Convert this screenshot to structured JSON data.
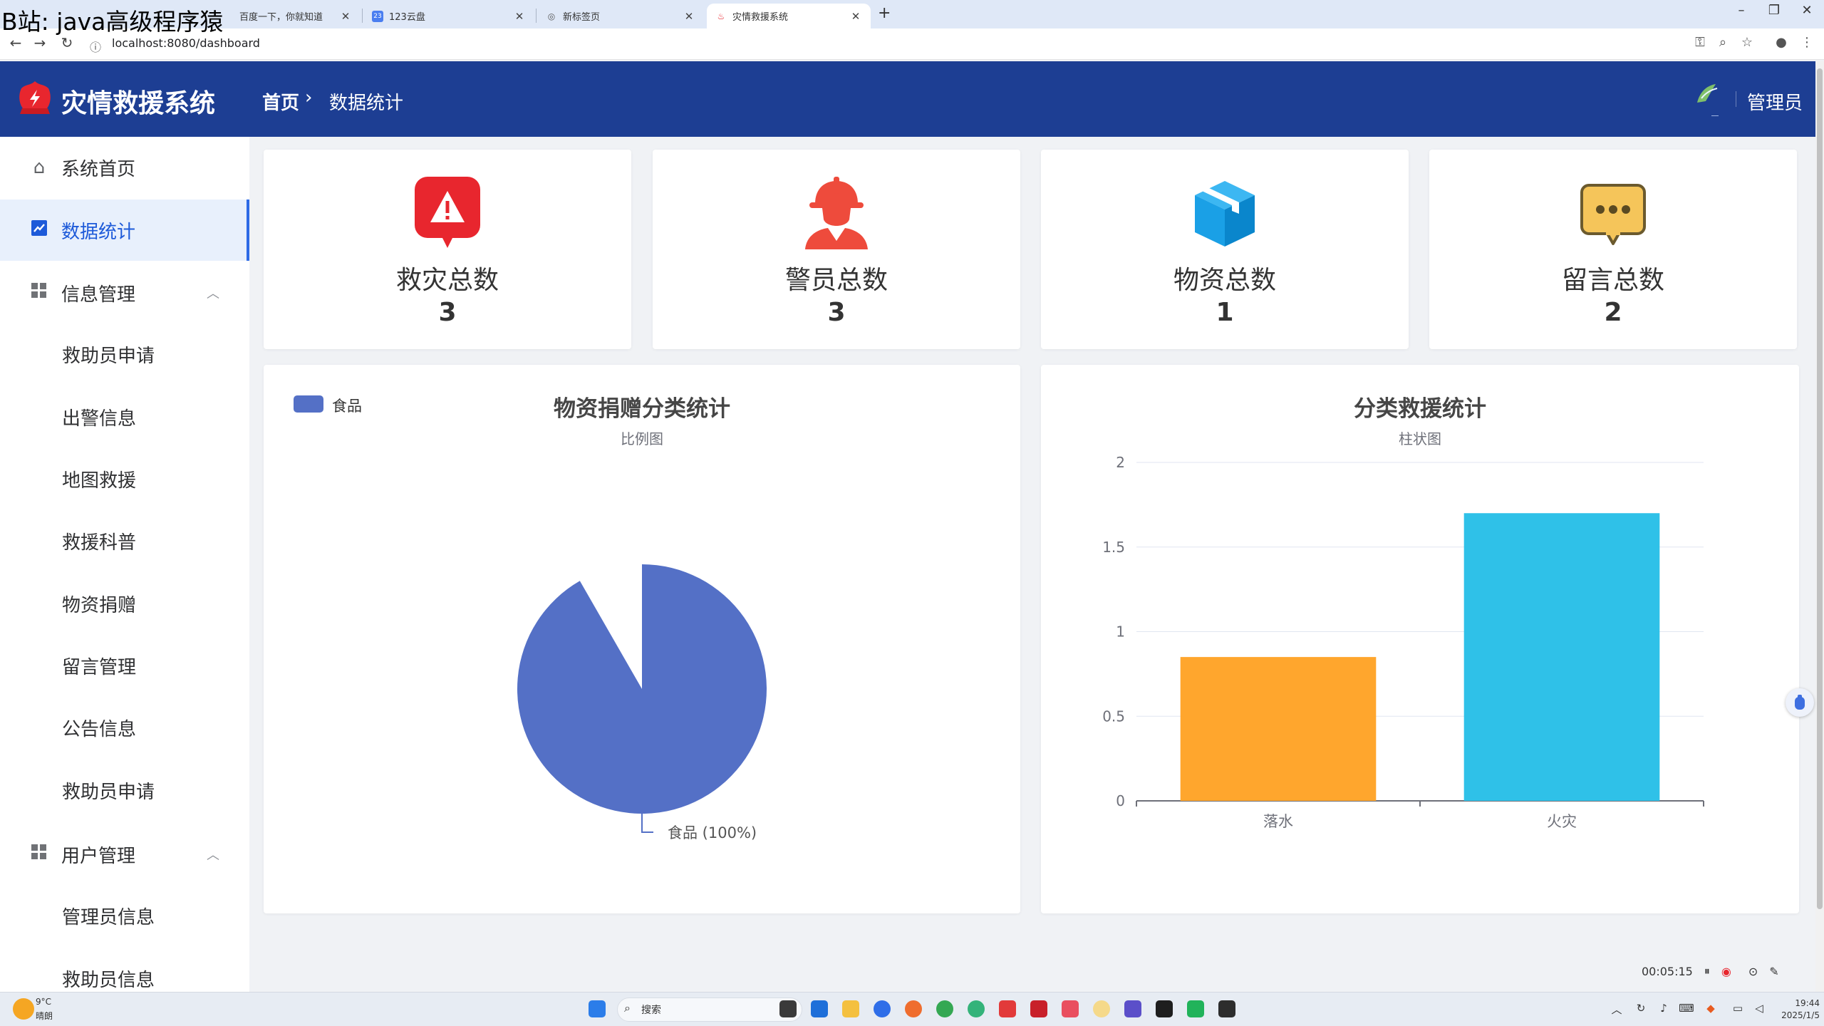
{
  "watermark": "B站: java高级程序猿",
  "browser": {
    "tabs": [
      {
        "title": "百度一下，你就知道",
        "active": false
      },
      {
        "title": "123云盘",
        "active": false
      },
      {
        "title": "新标签页",
        "active": false
      },
      {
        "title": "灾情救援系统",
        "active": true
      }
    ],
    "url": "localhost:8080/dashboard"
  },
  "header": {
    "title": "灾情救援系统",
    "breadcrumb_home": "首页",
    "breadcrumb_current": "数据统计",
    "admin_name": "管理员"
  },
  "sidebar": {
    "home": "系统首页",
    "stats": "数据统计",
    "info_group": "信息管理",
    "info_items": [
      "救助员申请",
      "出警信息",
      "地图救援",
      "救援科普",
      "物资捐赠",
      "留言管理",
      "公告信息",
      "救助员申请"
    ],
    "user_group": "用户管理",
    "user_items": [
      "管理员信息",
      "救助员信息"
    ]
  },
  "stats": [
    {
      "label": "救灾总数",
      "value": "3",
      "icon": "warning-icon",
      "color": "#e8262e"
    },
    {
      "label": "警员总数",
      "value": "3",
      "icon": "firefighter-icon",
      "color": "#ee4b3c"
    },
    {
      "label": "物资总数",
      "value": "1",
      "icon": "package-box-icon",
      "color": "#1aa0e6"
    },
    {
      "label": "留言总数",
      "value": "2",
      "icon": "message-bubble-icon",
      "color": "#f5c55a"
    }
  ],
  "pie_chart": {
    "title": "物资捐赠分类统计",
    "subtitle": "比例图",
    "legend": [
      "食品"
    ],
    "slice_label": "食品 (100%)"
  },
  "bar_chart": {
    "title": "分类救援统计",
    "subtitle": "柱状图"
  },
  "chart_data": [
    {
      "type": "pie",
      "title": "物资捐赠分类统计",
      "subtitle": "比例图",
      "categories": [
        "食品"
      ],
      "values": [
        1
      ],
      "labels": [
        "食品 (100%)"
      ],
      "colors": [
        "#5470c6"
      ],
      "legend_placement": "top-left"
    },
    {
      "type": "bar",
      "title": "分类救援统计",
      "subtitle": "柱状图",
      "categories": [
        "落水",
        "火灾"
      ],
      "values": [
        0.85,
        1.7
      ],
      "colors": [
        "#ffa62d",
        "#2fc1e8"
      ],
      "ylim": [
        0,
        2
      ],
      "yticks": [
        "0",
        "0.5",
        "1",
        "1.5",
        "2"
      ],
      "grid": true
    }
  ],
  "recorder": {
    "time": "00:05:15"
  },
  "taskbar": {
    "weather_temp": "9°C",
    "weather_desc": "晴朗",
    "search": "搜索",
    "time": "19:44",
    "date": "2025/1/5"
  },
  "colors": {
    "header": "#1d3e93",
    "accent": "#2d6ae6",
    "page_bg": "#f0f2f5"
  }
}
